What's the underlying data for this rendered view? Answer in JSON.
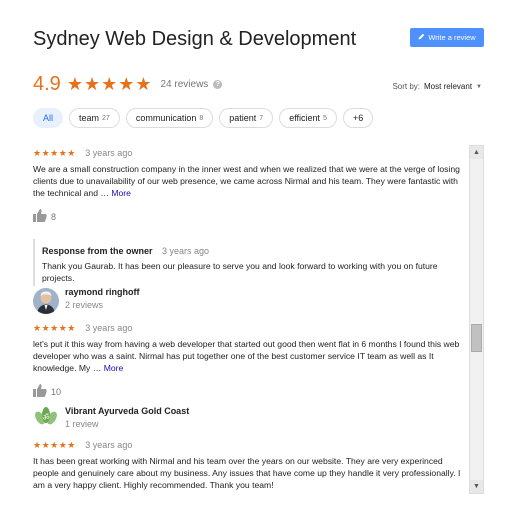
{
  "business_title": "Sydney Web Design & Development",
  "write_review_label": "Write a review",
  "rating": "4.9",
  "rating_stars": "★★★★★",
  "reviews_count_label": "24 reviews",
  "sort": {
    "label": "Sort by:",
    "value": "Most relevant"
  },
  "chips": [
    {
      "label": "All",
      "count": ""
    },
    {
      "label": "team",
      "count": "27"
    },
    {
      "label": "communication",
      "count": "8"
    },
    {
      "label": "patient",
      "count": "7"
    },
    {
      "label": "efficient",
      "count": "5"
    },
    {
      "label": "+6",
      "count": ""
    }
  ],
  "reviews": [
    {
      "stars": "★★★★★",
      "ago": "3 years ago",
      "text": "We are a small construction company in the inner west and when we realized that we were at the verge of losing clients due to unavailability of our web presence, we came across Nirmal and his team. They were fantastic with the technical and …",
      "more": "More",
      "likes": "8",
      "owner_response": {
        "title": "Response from the owner",
        "ago": "3 years ago",
        "text": "Thank you Gaurab. It has been our pleasure to serve you and look forward to working with you on future projects."
      }
    },
    {
      "author": "raymond ringhoff",
      "sub": "2 reviews",
      "stars": "★★★★★",
      "ago": "3 years ago",
      "text": "let's put it this way from having a web developer that started out good then went flat in 6 months I found this web developer who was a saint.  Nirmal has put together one of the best customer service IT team as well as It knowledge. My …",
      "more": "More",
      "likes": "10"
    },
    {
      "author": "Vibrant Ayurveda Gold Coast",
      "sub": "1 review",
      "stars": "★★★★★",
      "ago": "3 years ago",
      "text": "It has been great working with Nirmal and his team over the years on our website. They are very experinced people and genuinely care about my business. Any issues that have come up they handle it very professionally. I am a very happy client. Highly recommended. Thank you team!"
    }
  ],
  "colors": {
    "accent_orange": "#e7711b",
    "button_blue": "#4d90fe",
    "link": "#1a0dab"
  }
}
